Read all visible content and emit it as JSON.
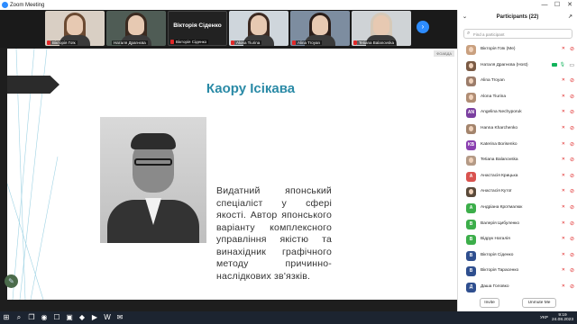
{
  "window": {
    "app_title": "Zoom Meeting",
    "minimize": "—",
    "maximize": "☐",
    "close": "✕"
  },
  "strip": {
    "thumbs": [
      {
        "name": "Вікторія Гоїк",
        "kind": "video",
        "hair": "#6b4a32",
        "bg": "#d9cfc4",
        "muted": true
      },
      {
        "name": "Наталя Драгнєва",
        "kind": "video",
        "hair": "#3a2a20",
        "bg": "#4f5c55",
        "muted": false
      },
      {
        "name": "Вікторія Сіденко",
        "kind": "nametile",
        "big": "Вікторія Сіденко",
        "muted": true
      },
      {
        "name": "Alona Tiurina",
        "kind": "video",
        "hair": "#3d2a22",
        "bg": "#cfd6dc",
        "muted": true
      },
      {
        "name": "Alina Troyan",
        "kind": "video",
        "hair": "#2b1e1a",
        "bg": "#7d8da0",
        "muted": true
      },
      {
        "name": "Tetiana Balanovska",
        "kind": "video",
        "hair": "#d6c9b8",
        "bg": "#cfd3d6",
        "muted": true
      }
    ],
    "next_icon": "›"
  },
  "slide": {
    "title": "Каору Ісікава",
    "text": "Видатний японський спеціаліст у сфері якості. Автор японського варіанту комплексного управління якістю та винахідник графічного методу причинно-наслідкових зв'язків.",
    "corner_label": "ФОАБДА"
  },
  "panel": {
    "title": "Participants (22)",
    "collapse_icon": "⌄",
    "more_icon": "↗",
    "search_placeholder": "Find a participant",
    "participants": [
      {
        "name": "Вікторія Гоїк (Me)",
        "avatar": "",
        "color": "#c9a07f",
        "photo": true,
        "mic": "off",
        "cam": "off"
      },
      {
        "name": "Наталя Драгнєва (Host)",
        "avatar": "",
        "color": "#7a5a44",
        "photo": true,
        "mic": "on",
        "cam": "on",
        "video": true
      },
      {
        "name": "Alina Troyan",
        "avatar": "",
        "color": "#9b7c6a",
        "photo": true,
        "mic": "off",
        "cam": "off"
      },
      {
        "name": "Alona Tiurina",
        "avatar": "",
        "color": "#b08d74",
        "photo": true,
        "mic": "off",
        "cam": "off"
      },
      {
        "name": "Angelina Nechyporuk",
        "avatar": "AN",
        "color": "#7b3fa0",
        "photo": false,
        "mic": "off",
        "cam": "off"
      },
      {
        "name": "Hanna Kharchenko",
        "avatar": "",
        "color": "#a3846c",
        "photo": true,
        "mic": "off",
        "cam": "off"
      },
      {
        "name": "Katerina Borisenko",
        "avatar": "KB",
        "color": "#8a3fb0",
        "photo": false,
        "mic": "off",
        "cam": "off"
      },
      {
        "name": "Tetiana Balanovska",
        "avatar": "",
        "color": "#b49a86",
        "photo": true,
        "mic": "off",
        "cam": "off"
      },
      {
        "name": "Анастасія Крицька",
        "avatar": "А",
        "color": "#d9534f",
        "photo": false,
        "mic": "off",
        "cam": "off"
      },
      {
        "name": "Анастасія Кутої",
        "avatar": "",
        "color": "#5a4a3a",
        "photo": true,
        "mic": "off",
        "cam": "off"
      },
      {
        "name": "Андріана Кротмалюк",
        "avatar": "А",
        "color": "#3cae4a",
        "photo": false,
        "mic": "off",
        "cam": "off"
      },
      {
        "name": "Валерія Цибуленко",
        "avatar": "В",
        "color": "#3cae4a",
        "photo": false,
        "mic": "off",
        "cam": "off"
      },
      {
        "name": "Відрук Наталія",
        "avatar": "В",
        "color": "#3cae4a",
        "photo": false,
        "mic": "off",
        "cam": "off"
      },
      {
        "name": "Вікторія Сіденко",
        "avatar": "В",
        "color": "#2f4f8f",
        "photo": false,
        "mic": "off",
        "cam": "off"
      },
      {
        "name": "Вікторія Тарасенко",
        "avatar": "В",
        "color": "#2f4f8f",
        "photo": false,
        "mic": "off",
        "cam": "off"
      },
      {
        "name": "Даша Головко",
        "avatar": "Д",
        "color": "#2f4f8f",
        "photo": false,
        "mic": "off",
        "cam": "off"
      }
    ],
    "invite_label": "Invite",
    "unmute_label": "Unmute Me"
  },
  "taskbar": {
    "items": [
      "⊞",
      "⌕",
      "❐",
      "◉",
      "☐",
      "▣",
      "◆",
      "▶",
      "W",
      "✉"
    ],
    "tray_lang": "УКР",
    "time": "9:19",
    "date": "24.08.2023"
  },
  "colors": {
    "accent": "#2d8cff",
    "muted": "#e02828",
    "title": "#2a8aa6"
  }
}
